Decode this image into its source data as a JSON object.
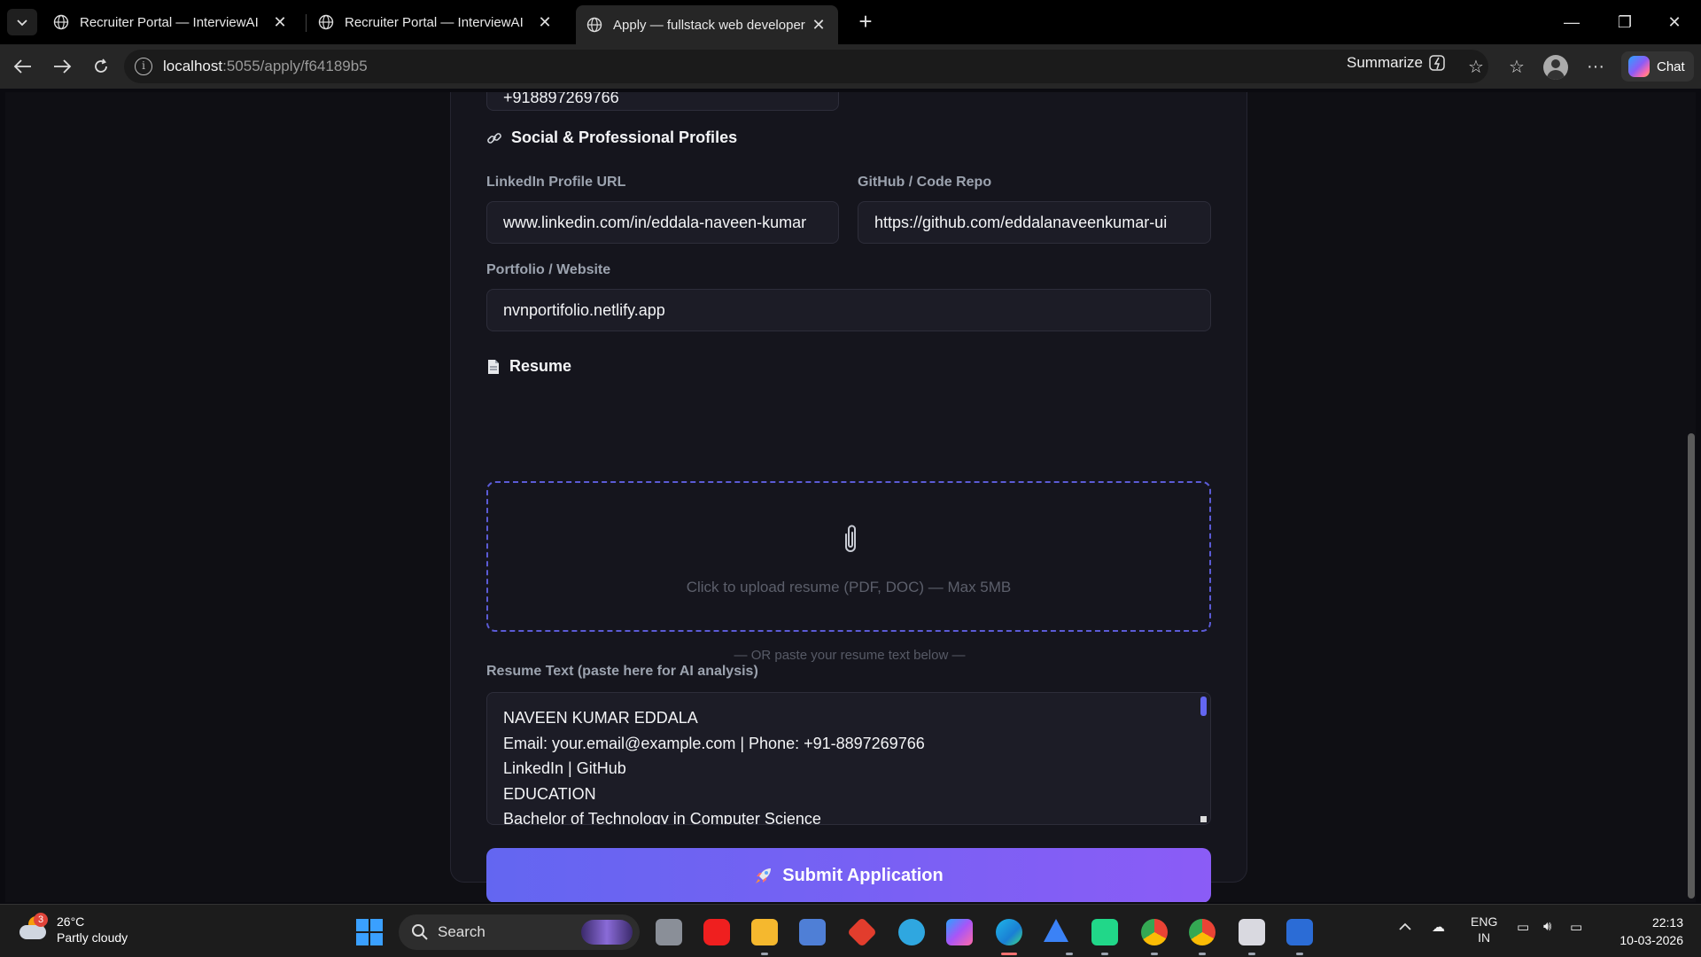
{
  "browser": {
    "tabs": [
      {
        "title": "Recruiter Portal — InterviewAI",
        "active": false
      },
      {
        "title": "Recruiter Portal — InterviewAI",
        "active": false
      },
      {
        "title": "Apply — fullstack web developer |",
        "active": true
      }
    ],
    "url_host": "localhost",
    "url_path": ":5055/apply/f64189b5",
    "summarize_label": "Summarize",
    "chat_label": "Chat"
  },
  "form": {
    "phone_value": "+918897269766",
    "social_section_title": "Social & Professional Profiles",
    "linkedin_label": "LinkedIn Profile URL",
    "linkedin_value": "www.linkedin.com/in/eddala-naveen-kumar",
    "github_label": "GitHub / Code Repo",
    "github_value": "https://github.com/eddalanaveenkumar-ui",
    "portfolio_label": "Portfolio / Website",
    "portfolio_value": "nvnportifolio.netlify.app",
    "resume_section_title": "Resume",
    "upload_text": "Click to upload resume (PDF, DOC) — Max 5MB",
    "or_text": "— OR paste your resume text below —",
    "resume_text_label": "Resume Text (paste here for AI analysis)",
    "resume_lines": [
      "NAVEEN KUMAR EDDALA",
      "Email: your.email@example.com | Phone: +91-8897269766",
      "LinkedIn | GitHub",
      "EDUCATION",
      "Bachelor of Technology in Computer Science"
    ],
    "submit_label": "Submit Application"
  },
  "taskbar": {
    "weather_badge": "3",
    "temperature": "26°C",
    "weather_desc": "Partly cloudy",
    "search_label": "Search",
    "lang_top": "ENG",
    "lang_bottom": "IN",
    "time": "22:13",
    "date": "10-03-2026"
  },
  "colors": {
    "accent": "#6366f1",
    "accent_end": "#8b5cf6",
    "page_bg": "#0f0f14",
    "card_bg": "#15151d"
  }
}
